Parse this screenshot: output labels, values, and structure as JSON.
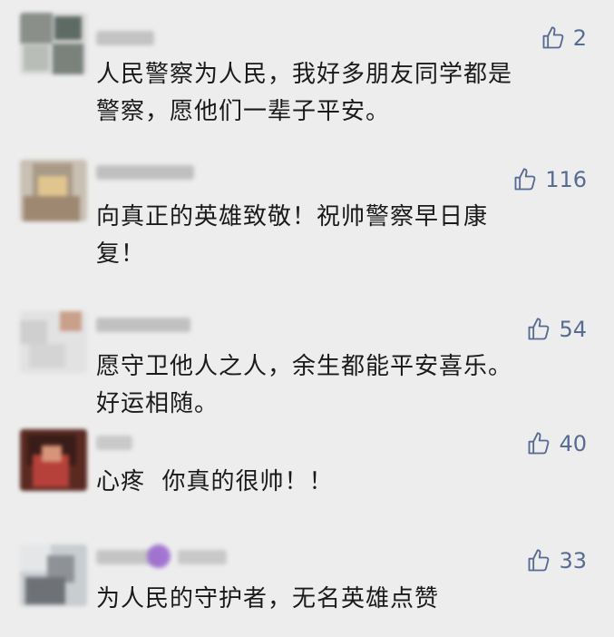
{
  "comments": [
    {
      "likes": "2",
      "text": "人民警察为人民，我好多朋友同学都是\n警察，愿他们一辈子平安。"
    },
    {
      "likes": "116",
      "text": "向真正的英雄致敬！祝帅警察早日康\n复！"
    },
    {
      "likes": "54",
      "text": "愿守卫他人之人，余生都能平安喜乐。\n好运相随。"
    },
    {
      "likes": "40",
      "text": "心疼  你真的很帅！！"
    },
    {
      "likes": "33",
      "text": "为人民的守护者，无名英雄点赞"
    }
  ],
  "icons": {
    "like": "thumbs-up-icon"
  },
  "colors": {
    "background": "#ededed",
    "like_text": "#576b95",
    "comment_text": "#1a1a1a"
  }
}
